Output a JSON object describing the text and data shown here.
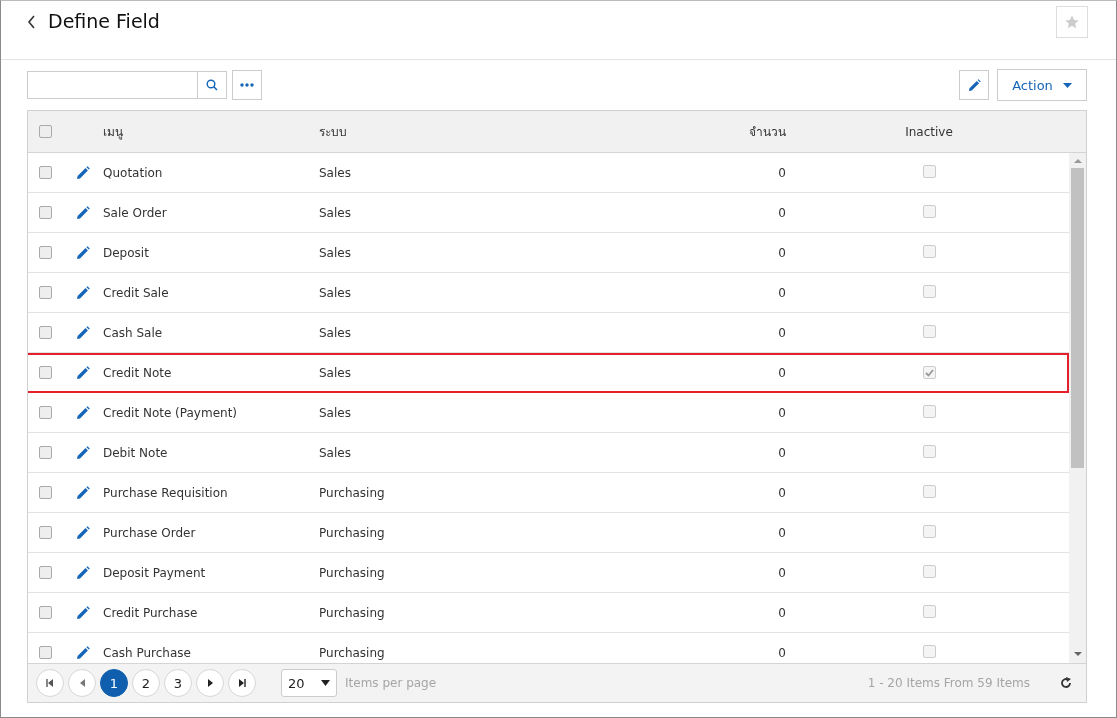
{
  "page": {
    "title": "Define Field"
  },
  "toolbar": {
    "action_label": "Action"
  },
  "table": {
    "select_all": {
      "checked": false
    },
    "columns": [
      {
        "label": "เมนู"
      },
      {
        "label": "ระบบ"
      },
      {
        "label": "จำนวน"
      },
      {
        "label": "Inactive"
      }
    ],
    "rows": [
      {
        "menu": "Quotation",
        "system": "Sales",
        "count": "0",
        "inactive": false,
        "highlighted": false
      },
      {
        "menu": "Sale Order",
        "system": "Sales",
        "count": "0",
        "inactive": false,
        "highlighted": false
      },
      {
        "menu": "Deposit",
        "system": "Sales",
        "count": "0",
        "inactive": false,
        "highlighted": false
      },
      {
        "menu": "Credit Sale",
        "system": "Sales",
        "count": "0",
        "inactive": false,
        "highlighted": false
      },
      {
        "menu": "Cash Sale",
        "system": "Sales",
        "count": "0",
        "inactive": false,
        "highlighted": false
      },
      {
        "menu": "Credit Note",
        "system": "Sales",
        "count": "0",
        "inactive": true,
        "highlighted": true
      },
      {
        "menu": "Credit Note (Payment)",
        "system": "Sales",
        "count": "0",
        "inactive": false,
        "highlighted": false
      },
      {
        "menu": "Debit Note",
        "system": "Sales",
        "count": "0",
        "inactive": false,
        "highlighted": false
      },
      {
        "menu": "Purchase Requisition",
        "system": "Purchasing",
        "count": "0",
        "inactive": false,
        "highlighted": false
      },
      {
        "menu": "Purchase Order",
        "system": "Purchasing",
        "count": "0",
        "inactive": false,
        "highlighted": false
      },
      {
        "menu": "Deposit Payment",
        "system": "Purchasing",
        "count": "0",
        "inactive": false,
        "highlighted": false
      },
      {
        "menu": "Credit Purchase",
        "system": "Purchasing",
        "count": "0",
        "inactive": false,
        "highlighted": false
      },
      {
        "menu": "Cash Purchase",
        "system": "Purchasing",
        "count": "0",
        "inactive": false,
        "highlighted": false
      }
    ]
  },
  "pager": {
    "pages": [
      {
        "label": "1",
        "selected": true
      },
      {
        "label": "2",
        "selected": false
      },
      {
        "label": "3",
        "selected": false
      }
    ],
    "page_size": "20",
    "page_size_label": "Items per page",
    "summary": "1 - 20 Items From 59 Items"
  }
}
